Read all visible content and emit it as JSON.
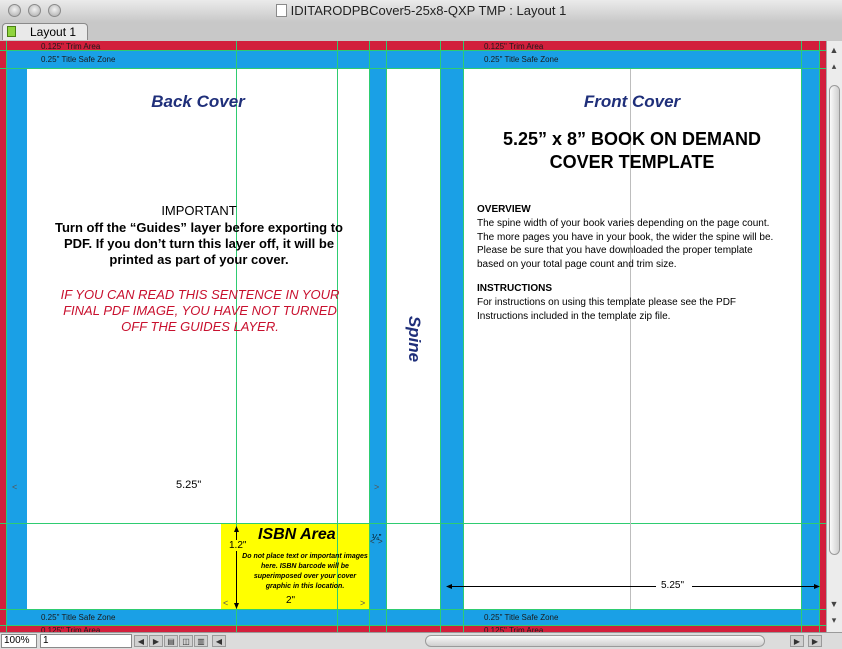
{
  "window": {
    "title": "IDITARODPBCover5-25x8-QXP TMP : Layout 1",
    "tab_label": "Layout 1"
  },
  "template": {
    "trim_area_label": "0.125\" Trim Area",
    "title_safe_label": "0.25\" Title Safe Zone",
    "back_cover_title": "Back Cover",
    "front_cover_title": "Front Cover",
    "spine_label": "Spine",
    "important_heading": "IMPORTANT",
    "important_text": "Turn off the “Guides” layer before exporting to PDF.  If you don’t turn this layer off, it will be printed as part of your cover.",
    "warning_text": "IF YOU CAN READ THIS SENTENCE IN YOUR FINAL PDF IMAGE, YOU HAVE NOT TURNED OFF THE GUIDES LAYER.",
    "template_title": "5.25” x 8” BOOK ON DEMAND COVER TEMPLATE",
    "overview_heading": "OVERVIEW",
    "overview_text": "The spine width of your book varies depending on the page count.  The more pages you have in your book, the wider the spine will be.  Please be sure that you have downloaded the proper template based on your total page count and trim size.",
    "instructions_heading": "INSTRUCTIONS",
    "instructions_text": "For instructions on using this template please see the PDF Instructions included in the template zip file.",
    "back_width_label": "5.25\"",
    "front_width_label": "5.25\"",
    "isbn_title": "ISBN Area",
    "isbn_note": "Do not place text or important images here. ISBN barcode will be superimposed over your cover graphic in this location.",
    "isbn_height_label": "1.2\"",
    "isbn_width_label": "2\"",
    "quarter_label": "¼\""
  },
  "status": {
    "zoom": "100%",
    "page": "1"
  },
  "colors": {
    "trim_red": "#d21f3c",
    "safe_blue": "#1aa0e6",
    "guide_green": "#2ecc71",
    "isbn_yellow": "#ffff00",
    "heading_blue": "#1f2f7a",
    "warning_red": "#c8102e"
  }
}
